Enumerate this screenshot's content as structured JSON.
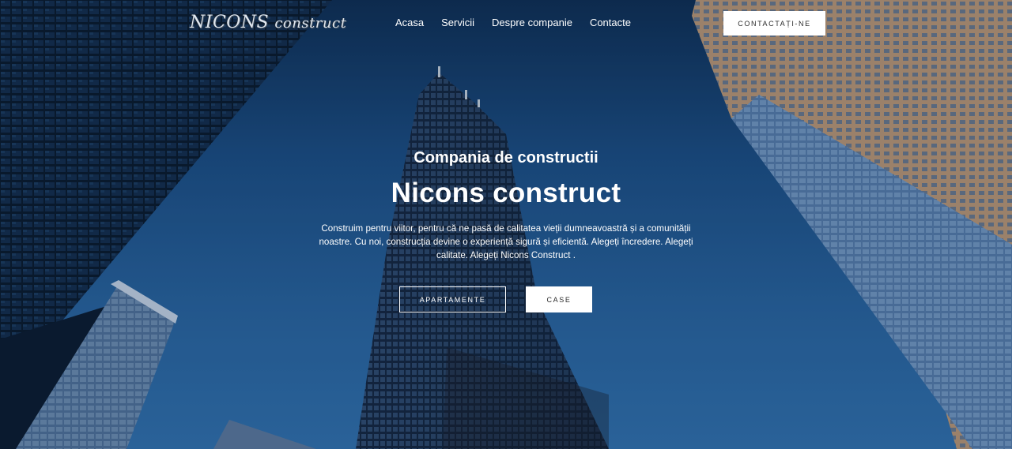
{
  "header": {
    "logo_main": "NICONS",
    "logo_sub": "construct",
    "nav": [
      "Acasa",
      "Servicii",
      "Despre companie",
      "Contacte"
    ],
    "contact_label": "CONTACTAȚI-NE"
  },
  "hero": {
    "subtitle": "Compania de constructii",
    "title": "Nicons construct",
    "description": "Construim pentru viitor, pentru că ne pasă de calitatea vieții dumneavoastră și a comunității noastre. Cu noi, construcția devine o experiență sigură și eficientă. Alegeți încredere. Alegeți calitate. Alegeți Nicons Construct .",
    "button_apartments": "APARTAMENTE",
    "button_houses": "CASE"
  },
  "colors": {
    "sky": "#2a66a2",
    "button_bg": "#ffffff",
    "button_text": "#2b2b2b"
  }
}
